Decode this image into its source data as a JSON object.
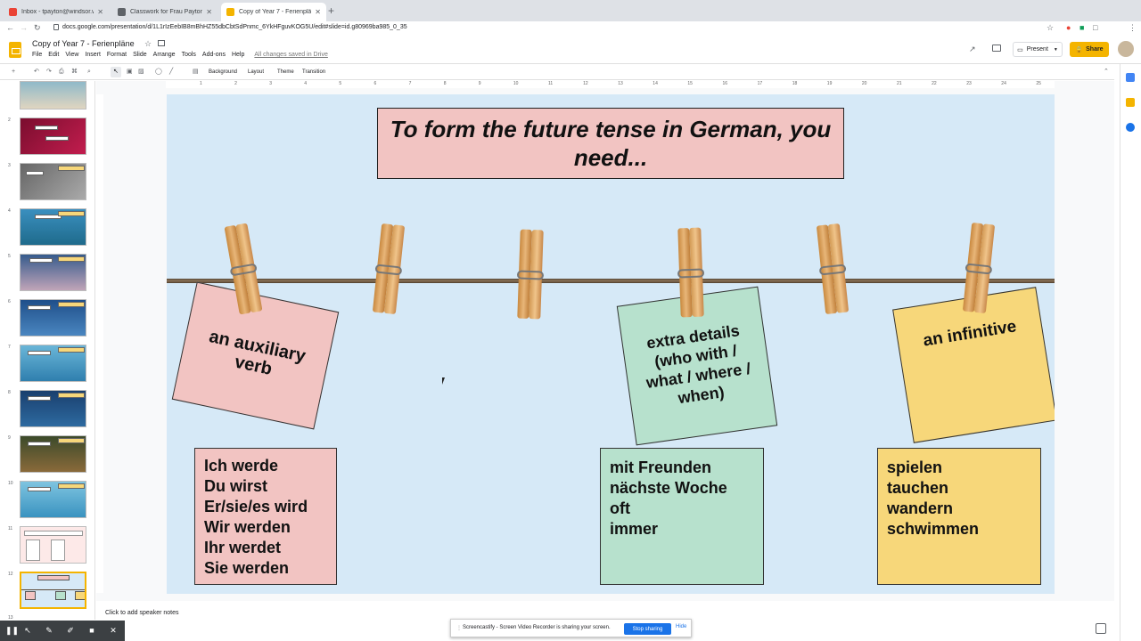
{
  "browser": {
    "tabs": [
      {
        "label": "Inbox - tpayton@windsor.wind...",
        "color": "#ea4335"
      },
      {
        "label": "Classwork for Frau Payton 7L...",
        "color": "#5f6368"
      },
      {
        "label": "Copy of Year 7 - Ferienpläne -...",
        "color": "#f4b400"
      }
    ],
    "new_tab": "+",
    "url": "docs.google.com/presentation/d/1L1rIzEebIB8mBhHZ55dbCbtSdPnmc_6YkHFguvKOG5U/edit#slide=id.g80969ba985_0_35"
  },
  "app": {
    "title": "Copy of Year 7 - Ferienpläne",
    "menus": [
      "File",
      "Edit",
      "View",
      "Insert",
      "Format",
      "Slide",
      "Arrange",
      "Tools",
      "Add-ons",
      "Help"
    ],
    "saved_status": "All changes saved in Drive",
    "present_label": "Present",
    "share_label": "Share"
  },
  "toolbar": {
    "background": "Background",
    "layout": "Layout",
    "theme": "Theme",
    "transition": "Transition"
  },
  "ruler": {
    "h_numbers": [
      "1",
      "2",
      "3",
      "4",
      "5",
      "6",
      "7",
      "8",
      "9",
      "10",
      "11",
      "12",
      "13",
      "14",
      "15",
      "16",
      "17",
      "18",
      "19",
      "20",
      "21",
      "22",
      "23",
      "24",
      "25"
    ]
  },
  "filmstrip": {
    "numbers": [
      "2",
      "3",
      "4",
      "5",
      "6",
      "7",
      "8",
      "9",
      "10",
      "11",
      "12",
      "13"
    ],
    "selected": "12"
  },
  "slide": {
    "title": "To form the future tense in German, you need...",
    "notes": {
      "auxiliary": "an auxiliary verb",
      "extra": "extra details (who with / what / where / when)",
      "infinitive": "an infinitive"
    },
    "lists": {
      "werden": [
        "Ich werde",
        "Du wirst",
        "Er/sie/es wird",
        "Wir werden",
        "Ihr werdet",
        "Sie werden"
      ],
      "details": [
        "mit Freunden",
        "nächste Woche",
        "oft",
        "immer"
      ],
      "infinitives": [
        "spielen",
        "tauchen",
        "wandern",
        "schwimmen"
      ]
    },
    "colors": {
      "background": "#d6e9f7",
      "pink": "#f2c4c2",
      "green": "#b7e1cd",
      "yellow": "#f7d77a"
    }
  },
  "speaker_notes": "Click to add speaker notes",
  "screencastify": {
    "message": "Screencastify - Screen Video Recorder is sharing your screen.",
    "stop": "Stop sharing",
    "hide": "Hide"
  }
}
